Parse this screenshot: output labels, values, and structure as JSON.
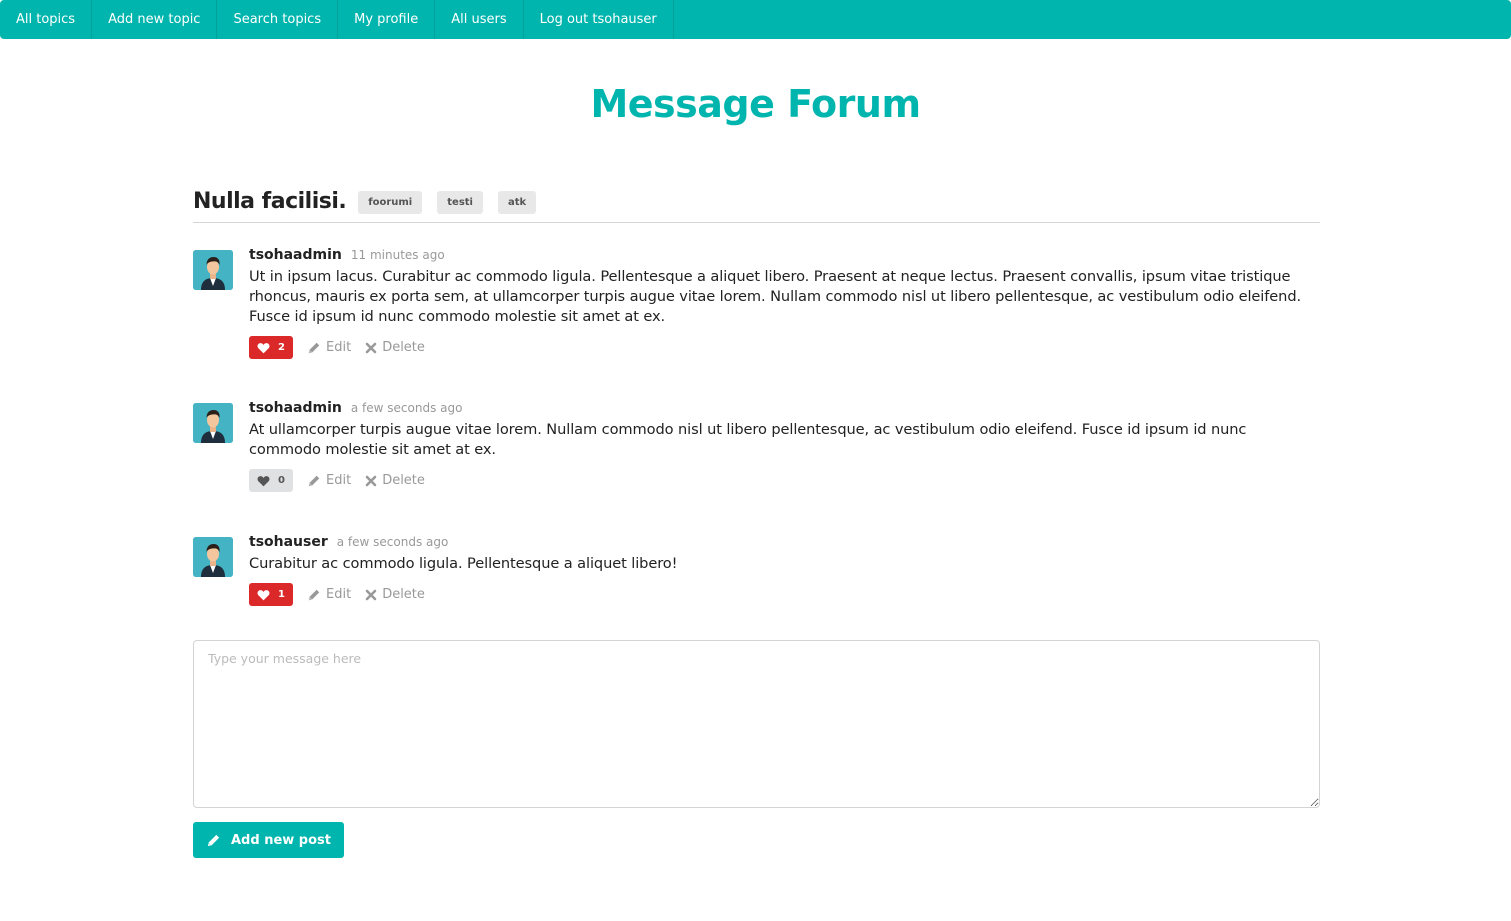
{
  "nav": {
    "items": [
      {
        "label": "All topics"
      },
      {
        "label": "Add new topic"
      },
      {
        "label": "Search topics"
      },
      {
        "label": "My profile"
      },
      {
        "label": "All users"
      },
      {
        "label": "Log out tsohauser"
      }
    ]
  },
  "site": {
    "title": "Message Forum"
  },
  "topic": {
    "title": "Nulla facilisi.",
    "tags": [
      "foorumi",
      "testi",
      "atk"
    ]
  },
  "posts": [
    {
      "author": "tsohaadmin",
      "time": "11 minutes ago",
      "text": "Ut in ipsum lacus. Curabitur ac commodo ligula. Pellentesque a aliquet libero. Praesent at neque lectus. Praesent convallis, ipsum vitae tristique rhoncus, mauris ex porta sem, at ullamcorper turpis augue vitae lorem. Nullam commodo nisl ut libero pellentesque, ac vestibulum odio eleifend. Fusce id ipsum id nunc commodo molestie sit amet at ex.",
      "likes": "2",
      "liked": true,
      "edit_label": "Edit",
      "delete_label": "Delete"
    },
    {
      "author": "tsohaadmin",
      "time": "a few seconds ago",
      "text": "At ullamcorper turpis augue vitae lorem. Nullam commodo nisl ut libero pellentesque, ac vestibulum odio eleifend. Fusce id ipsum id nunc commodo molestie sit amet at ex.",
      "likes": "0",
      "liked": false,
      "edit_label": "Edit",
      "delete_label": "Delete"
    },
    {
      "author": "tsohauser",
      "time": "a few seconds ago",
      "text": "Curabitur ac commodo ligula. Pellentesque a aliquet libero!",
      "likes": "1",
      "liked": true,
      "edit_label": "Edit",
      "delete_label": "Delete"
    }
  ],
  "form": {
    "message_value": "",
    "message_placeholder": "Type your message here",
    "submit_label": "Add new post"
  },
  "colors": {
    "accent": "#00b5ad",
    "like_active": "#db2828",
    "like_inactive": "#e0e1e2"
  },
  "icons": {
    "like": "heart-icon",
    "edit": "pencil-icon",
    "delete": "close-icon",
    "avatar": "user-avatar",
    "submit": "pencil-icon"
  }
}
